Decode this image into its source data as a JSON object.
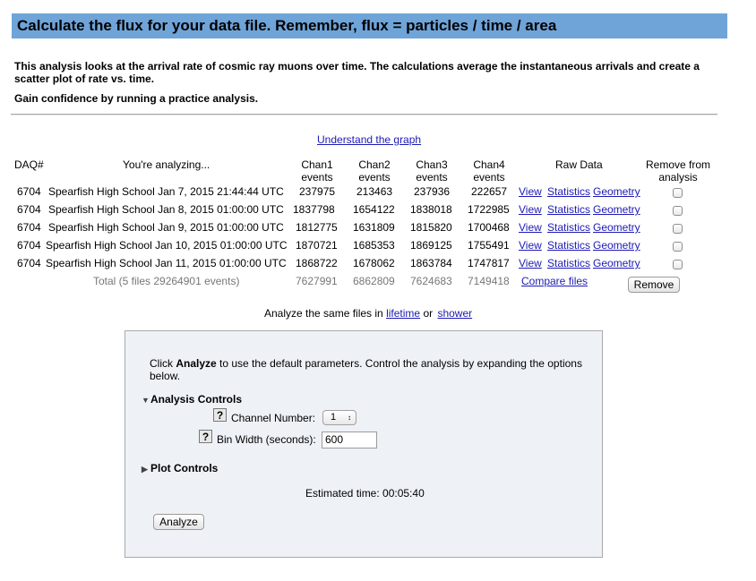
{
  "header": {
    "title": "Calculate the flux for your data file. Remember, flux = particles / time / area"
  },
  "intro": {
    "description": "This analysis looks at the arrival rate of cosmic ray muons over time. The calculations average the instantaneous arrivals and create a scatter plot of rate vs. time.",
    "practice": "Gain confidence by running a practice analysis."
  },
  "understand_link": "Understand the graph",
  "table": {
    "headers": {
      "daq": "DAQ#",
      "analyzing": "You're analyzing...",
      "chan1_a": "Chan1",
      "chan1_b": "events",
      "chan2_a": "Chan2",
      "chan2_b": "events",
      "chan3_a": "Chan3",
      "chan3_b": "events",
      "chan4_a": "Chan4",
      "chan4_b": "events",
      "raw": "Raw Data",
      "remove_a": "Remove from",
      "remove_b": "analysis"
    },
    "rows": [
      {
        "daq": "6704",
        "file": "Spearfish High School Jan 7, 2015 21:44:44 UTC",
        "c1": "237975",
        "c2": "213463",
        "c3": "237936",
        "c4": "222657",
        "view": "View",
        "stats": "Statistics",
        "geom": "Geometry"
      },
      {
        "daq": "6704",
        "file": "Spearfish High School Jan 8, 2015 01:00:00 UTC",
        "c1": "1837798",
        "c2": "1654122",
        "c3": "1838018",
        "c4": "1722985",
        "view": "View",
        "stats": "Statistics",
        "geom": "Geometry"
      },
      {
        "daq": "6704",
        "file": "Spearfish High School Jan 9, 2015 01:00:00 UTC",
        "c1": "1812775",
        "c2": "1631809",
        "c3": "1815820",
        "c4": "1700468",
        "view": "View",
        "stats": "Statistics",
        "geom": "Geometry"
      },
      {
        "daq": "6704",
        "file": "Spearfish High School Jan 10, 2015 01:00:00 UTC",
        "c1": "1870721",
        "c2": "1685353",
        "c3": "1869125",
        "c4": "1755491",
        "view": "View",
        "stats": "Statistics",
        "geom": "Geometry"
      },
      {
        "daq": "6704",
        "file": "Spearfish High School Jan 11, 2015 01:00:00 UTC",
        "c1": "1868722",
        "c2": "1678062",
        "c3": "1863784",
        "c4": "1747817",
        "view": "View",
        "stats": "Statistics",
        "geom": "Geometry"
      }
    ],
    "total": {
      "label": "Total (5 files 29264901 events)",
      "c1": "7627991",
      "c2": "6862809",
      "c3": "7624683",
      "c4": "7149418",
      "compare": "Compare files",
      "remove_button": "Remove"
    }
  },
  "same_files": {
    "prefix": "Analyze the same files in",
    "lifetime": "lifetime",
    "or": "or",
    "shower": "shower"
  },
  "panel": {
    "text_pre": "Click ",
    "text_bold": "Analyze",
    "text_post": " to use the default parameters. Control the analysis by expanding the options below.",
    "analysis_controls": "Analysis Controls",
    "channel_label": "Channel Number:",
    "channel_value": "1",
    "bin_label": "Bin Width (seconds):",
    "bin_value": "600",
    "plot_controls": "Plot Controls",
    "estimated": "Estimated time: 00:05:40",
    "analyze_button": "Analyze",
    "help_glyph": "?"
  },
  "colors": {
    "title_bar": "#6fa4d9",
    "link": "#1d1ab5",
    "panel_bg": "#eef2f7"
  }
}
